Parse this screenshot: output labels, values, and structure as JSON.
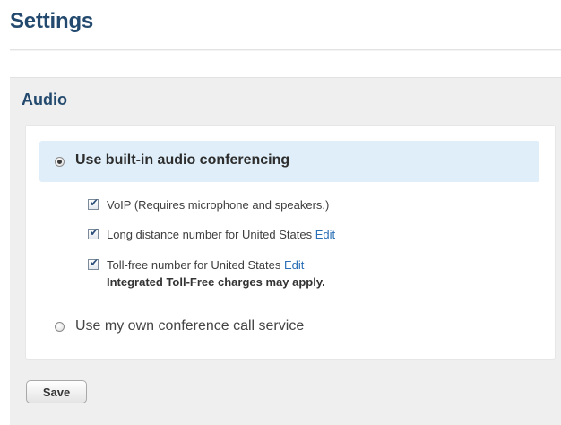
{
  "page": {
    "title": "Settings"
  },
  "audio": {
    "section_title": "Audio",
    "builtin_option": {
      "label": "Use built-in audio conferencing",
      "selected": true
    },
    "checkboxes": [
      {
        "label": "VoIP (Requires microphone and speakers.)",
        "checked": true
      },
      {
        "label": "Long distance number for United States",
        "checked": true,
        "link": "Edit"
      },
      {
        "label": "Toll-free number for United States",
        "checked": true,
        "link": "Edit"
      }
    ],
    "toll_free_notice": "Integrated Toll-Free charges may apply.",
    "own_service_option": {
      "label": "Use my own conference call service",
      "selected": false
    }
  },
  "actions": {
    "save_label": "Save"
  },
  "colors": {
    "heading": "#234a6e",
    "link": "#2a6fb5",
    "panel_background": "#efefef",
    "highlight_background": "#dfeef8"
  }
}
